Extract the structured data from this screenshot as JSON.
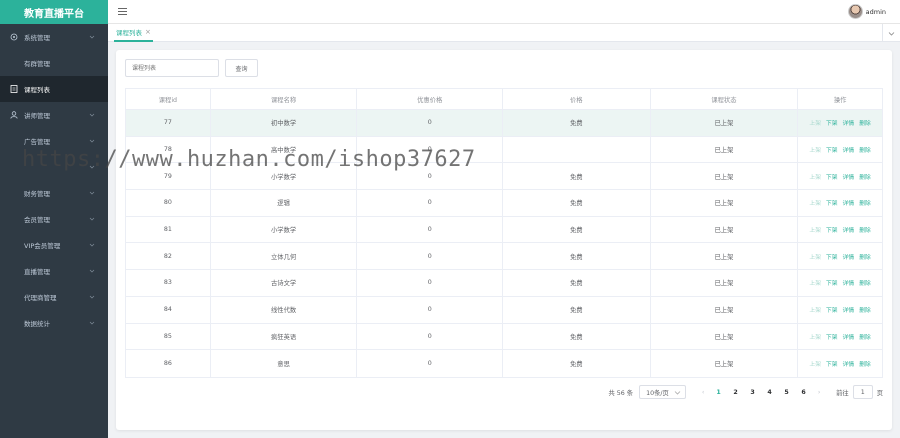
{
  "app": {
    "title": "教育直播平台"
  },
  "sidebar": {
    "items": [
      {
        "label": "系统管理",
        "icon": "gear-icon",
        "expand": true
      },
      {
        "label": "有群管理",
        "icon": "",
        "expand": false
      },
      {
        "label": "课程列表",
        "icon": "document-icon",
        "expand": false,
        "active": true
      },
      {
        "label": "讲师管理",
        "icon": "user-icon",
        "expand": true
      },
      {
        "label": "广告管理",
        "icon": "",
        "expand": true
      },
      {
        "label": "",
        "icon": "",
        "expand": true
      },
      {
        "label": "财务管理",
        "icon": "",
        "expand": true
      },
      {
        "label": "会员管理",
        "icon": "",
        "expand": true
      },
      {
        "label": "VIP会员管理",
        "icon": "",
        "expand": true
      },
      {
        "label": "直播管理",
        "icon": "",
        "expand": true
      },
      {
        "label": "代理商管理",
        "icon": "",
        "expand": true
      },
      {
        "label": "数据统计",
        "icon": "",
        "expand": true
      }
    ]
  },
  "header": {
    "username": "admin"
  },
  "tabs": [
    {
      "label": "课程列表",
      "close": "×"
    }
  ],
  "search": {
    "placeholder": "课程列表",
    "button_label": "查询"
  },
  "table": {
    "columns": [
      "课程id",
      "课程名称",
      "优惠价格",
      "价格",
      "课程状态",
      "操作"
    ],
    "rows": [
      {
        "id": "77",
        "name": "初中数学",
        "discount": "0",
        "price": "免费",
        "status": "已上架"
      },
      {
        "id": "78",
        "name": "高中数学",
        "discount": "0",
        "price": "",
        "status": "已上架"
      },
      {
        "id": "79",
        "name": "小学数学",
        "discount": "0",
        "price": "免费",
        "status": "已上架"
      },
      {
        "id": "80",
        "name": "逻辑",
        "discount": "0",
        "price": "免费",
        "status": "已上架"
      },
      {
        "id": "81",
        "name": "小学数学",
        "discount": "0",
        "price": "免费",
        "status": "已上架"
      },
      {
        "id": "82",
        "name": "立体几何",
        "discount": "0",
        "price": "免费",
        "status": "已上架"
      },
      {
        "id": "83",
        "name": "古诗文学",
        "discount": "0",
        "price": "免费",
        "status": "已上架"
      },
      {
        "id": "84",
        "name": "线性代数",
        "discount": "0",
        "price": "免费",
        "status": "已上架"
      },
      {
        "id": "85",
        "name": "疯狂英语",
        "discount": "0",
        "price": "免费",
        "status": "已上架"
      },
      {
        "id": "86",
        "name": "意思",
        "discount": "0",
        "price": "免费",
        "status": "已上架"
      }
    ],
    "actions": [
      "上架",
      "下架",
      "详情",
      "删除"
    ]
  },
  "pagination": {
    "total": "共 56 条",
    "page_size": "10条/页",
    "prev": "‹",
    "next": "›",
    "pages": [
      "1",
      "2",
      "3",
      "4",
      "5",
      "6"
    ],
    "current": "1",
    "goto_label": "前往",
    "goto_value": "1",
    "page_suffix": "页"
  },
  "watermark": "https://www.huzhan.com/ishop37627",
  "colors": {
    "accent": "#2cb29b",
    "sidebar_bg": "#2f3a44",
    "sidebar_active": "#1f272e",
    "row_highlight": "#ecf5f3"
  }
}
